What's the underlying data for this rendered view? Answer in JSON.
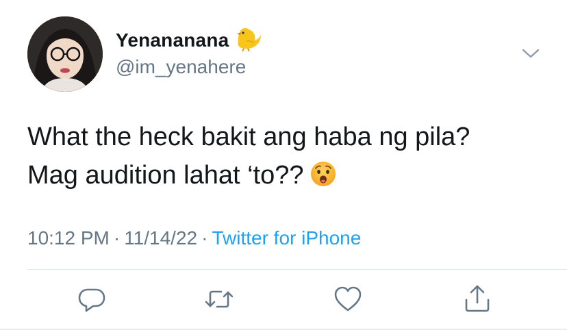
{
  "tweet": {
    "display_name": "Yenananana",
    "handle": "@im_yenahere",
    "text_line1": "What the heck bakit ang haba ng pila?",
    "text_line2": "Mag audition lahat ‘to??",
    "time": "10:12 PM",
    "date": "11/14/22",
    "separator": "·",
    "source": "Twitter for iPhone"
  },
  "icons": {
    "name_badge": "baby-chick-icon",
    "text_emoji": "anguished-face-emoji-icon",
    "menu": "chevron-down-icon",
    "reply": "reply-icon",
    "retweet": "retweet-icon",
    "like": "heart-icon",
    "share": "share-icon"
  },
  "colors": {
    "text": "#14171a",
    "secondary": "#657786",
    "link": "#1da1f2",
    "divider": "#e1e8ed"
  }
}
